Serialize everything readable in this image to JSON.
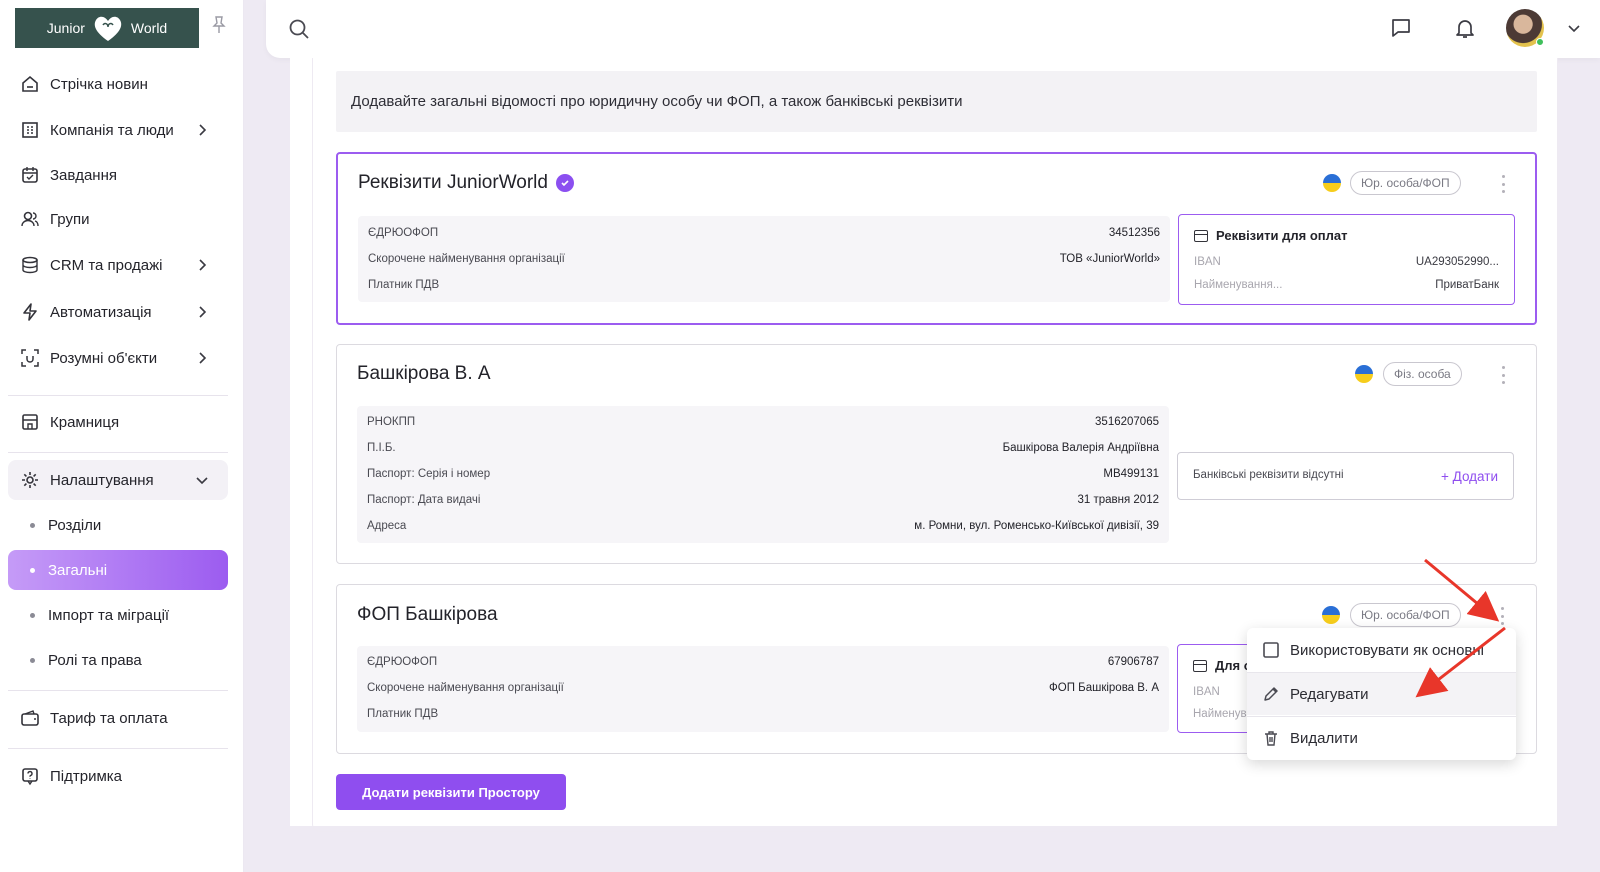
{
  "sidebar": {
    "logo": {
      "left": "Junior",
      "right": "World"
    },
    "items": [
      {
        "label": "Стрічка новин",
        "icon": "home-icon"
      },
      {
        "label": "Компанія та люди",
        "icon": "building-icon"
      },
      {
        "label": "Завдання",
        "icon": "calendar-icon"
      },
      {
        "label": "Групи",
        "icon": "users-icon"
      },
      {
        "label": "CRM та продажі",
        "icon": "database-icon"
      },
      {
        "label": "Автоматизація",
        "icon": "bolt-icon"
      },
      {
        "label": "Розумні об'єкти",
        "icon": "scan-icon"
      },
      {
        "label": "Крамниця",
        "icon": "store-icon"
      },
      {
        "label": "Налаштування",
        "icon": "gear-icon"
      },
      {
        "label": "Тариф та оплата",
        "icon": "wallet-icon"
      },
      {
        "label": "Підтримка",
        "icon": "help-icon"
      }
    ],
    "settings_sub": [
      {
        "label": "Розділи"
      },
      {
        "label": "Загальні"
      },
      {
        "label": "Імпорт та міграції"
      },
      {
        "label": "Ролі та права"
      }
    ]
  },
  "main": {
    "info_text": "Додавайте загальні відомості про юридичну особу чи ФОП, а також банківські реквізити",
    "cards": [
      {
        "title": "Реквізити JuniorWorld",
        "tag": "Юр. особа/ФОП",
        "fields": [
          {
            "k": "ЄДРЮОФОП",
            "v": "34512356"
          },
          {
            "k": "Скорочене найменування організації",
            "v": "ТОВ «JuniorWorld»"
          },
          {
            "k": "Платник ПДВ",
            "v": ""
          }
        ],
        "bank": {
          "title": "Реквізити для оплат",
          "iban_label": "IBAN",
          "iban_value": "UA293052990...",
          "name_label": "Найменування...",
          "name_value": "ПриватБанк"
        }
      },
      {
        "title": "Башкірова В. А",
        "tag": "Фіз. особа",
        "fields": [
          {
            "k": "РНОКПП",
            "v": "3516207065"
          },
          {
            "k": "П.І.Б.",
            "v": "Башкірова Валерія Андріївна"
          },
          {
            "k": "Паспорт: Серія і номер",
            "v": "МВ499131"
          },
          {
            "k": "Паспорт: Дата видачі",
            "v": "31 травня 2012"
          },
          {
            "k": "Адреса",
            "v": "м. Ромни, вул. Роменсько-Київської дивізії, 39"
          }
        ],
        "bank_empty": "Банківські реквізити відсутні",
        "add_label": "Додати"
      },
      {
        "title": "ФОП Башкірова",
        "tag": "Юр. особа/ФОП",
        "fields": [
          {
            "k": "ЄДРЮОФОП",
            "v": "67906787"
          },
          {
            "k": "Скорочене найменування організації",
            "v": "ФОП Башкірова В. А"
          },
          {
            "k": "Платник ПДВ",
            "v": ""
          }
        ],
        "bank": {
          "title": "Для о",
          "iban_label": "IBAN",
          "name_label": "Найменув"
        }
      }
    ],
    "add_button": "Додати реквізити Простору"
  },
  "context_menu": {
    "items": [
      {
        "label": "Використовувати як основні",
        "icon": "checkbox-icon"
      },
      {
        "label": "Редагувати",
        "icon": "pencil-icon"
      },
      {
        "label": "Видалити",
        "icon": "trash-icon"
      }
    ]
  },
  "colors": {
    "accent": "#8f4eef",
    "annotation_arrow": "#e8362a"
  }
}
